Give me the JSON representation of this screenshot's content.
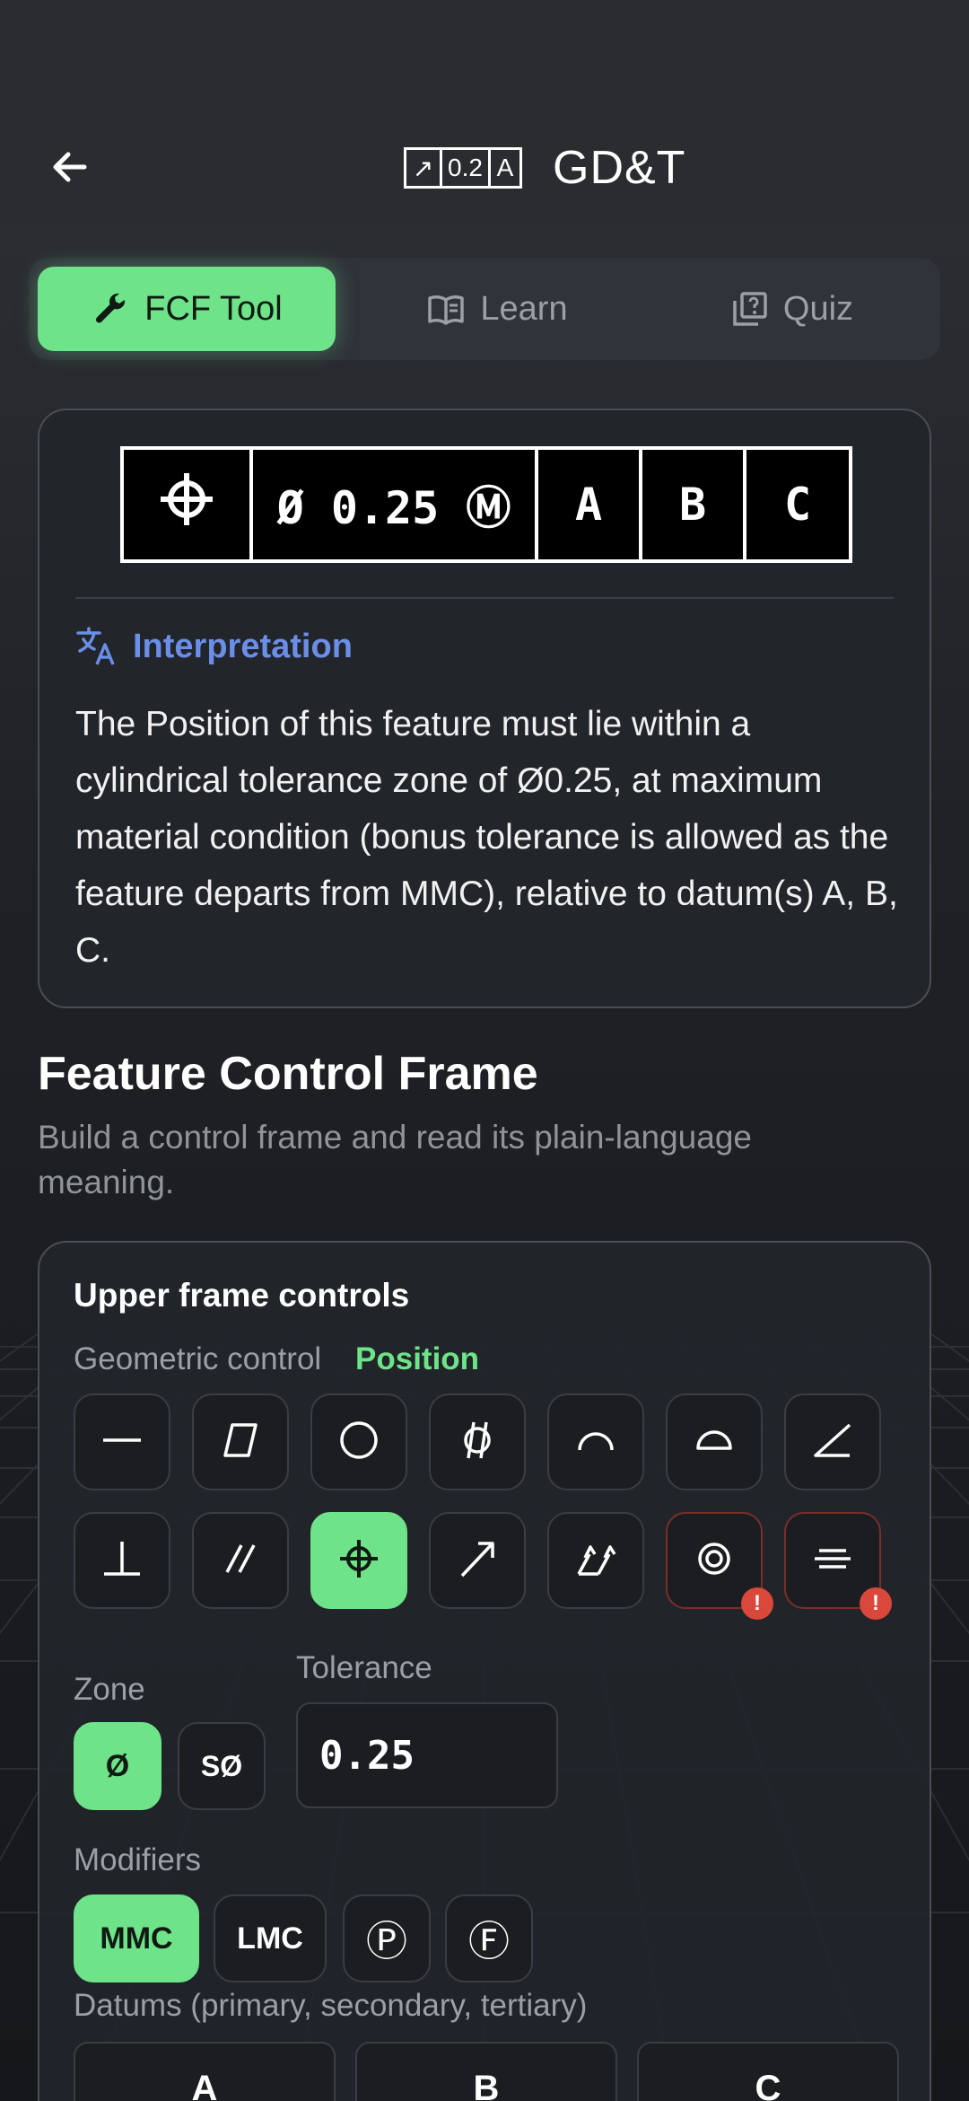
{
  "app": {
    "title": "GD&T",
    "logo_cells": [
      "↗",
      "0.2",
      "A"
    ]
  },
  "tabs": [
    {
      "label": "FCF Tool",
      "icon": "wrench-icon",
      "active": true
    },
    {
      "label": "Learn",
      "icon": "book-icon",
      "active": false
    },
    {
      "label": "Quiz",
      "icon": "quiz-icon",
      "active": false
    }
  ],
  "fcf": {
    "symbol": "position",
    "tolerance_text": "Ø 0.25 Ⓜ",
    "datums": [
      "A",
      "B",
      "C"
    ]
  },
  "interpretation": {
    "heading": "Interpretation",
    "text": "The Position of this feature must lie within a cylindrical tolerance zone of Ø0.25, at maximum material condition (bonus tolerance is allowed as the feature departs from MMC), relative to datum(s) A, B, C."
  },
  "section": {
    "title": "Feature Control Frame",
    "subtitle": "Build a control frame and read its plain-language meaning."
  },
  "controls": {
    "title": "Upper frame controls",
    "geometric_label": "Geometric control",
    "geometric_value": "Position",
    "symbols": [
      {
        "name": "straightness-icon",
        "active": false,
        "warn": false
      },
      {
        "name": "flatness-icon",
        "active": false,
        "warn": false
      },
      {
        "name": "circularity-icon",
        "active": false,
        "warn": false
      },
      {
        "name": "cylindricity-icon",
        "active": false,
        "warn": false
      },
      {
        "name": "profile-line-icon",
        "active": false,
        "warn": false
      },
      {
        "name": "profile-surface-icon",
        "active": false,
        "warn": false
      },
      {
        "name": "angularity-icon",
        "active": false,
        "warn": false
      },
      {
        "name": "perpendicularity-icon",
        "active": false,
        "warn": false
      },
      {
        "name": "parallelism-icon",
        "active": false,
        "warn": false
      },
      {
        "name": "position-icon",
        "active": true,
        "warn": false
      },
      {
        "name": "circular-runout-icon",
        "active": false,
        "warn": false
      },
      {
        "name": "total-runout-icon",
        "active": false,
        "warn": false
      },
      {
        "name": "concentricity-icon",
        "active": false,
        "warn": true
      },
      {
        "name": "symmetry-icon",
        "active": false,
        "warn": true
      }
    ],
    "warn_glyph": "!",
    "zone_label": "Zone",
    "zone_options": [
      {
        "label": "Ø",
        "active": true
      },
      {
        "label": "SØ",
        "active": false
      }
    ],
    "tolerance_label": "Tolerance",
    "tolerance_value": "0.25",
    "modifiers_label": "Modifiers",
    "modifiers": [
      {
        "label": "MMC",
        "active": true
      },
      {
        "label": "LMC",
        "active": false
      },
      {
        "label": "Ⓟ",
        "active": false
      },
      {
        "label": "Ⓕ",
        "active": false
      }
    ],
    "datums_label": "Datums (primary, secondary, tertiary)",
    "datum_fields": [
      "A",
      "B",
      "C"
    ]
  },
  "colors": {
    "accent": "#6ee389",
    "link": "#6b8ee8",
    "warn": "#d9483b",
    "background": "#1b1d21",
    "card": "#22252a"
  }
}
